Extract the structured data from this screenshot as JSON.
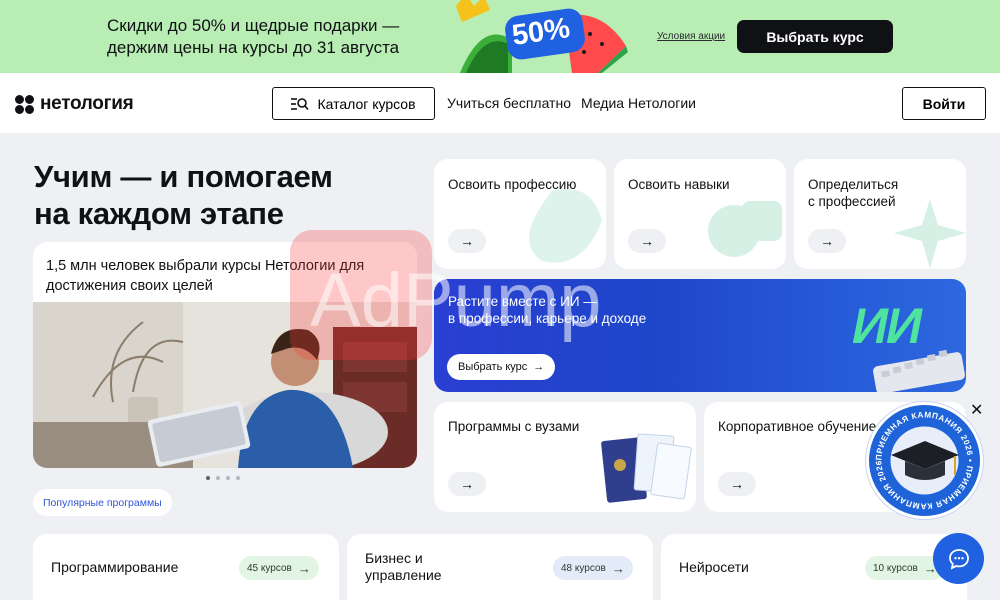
{
  "promo": {
    "line1": "Скидки до 50% и щедрые подарки —",
    "line2": "держим цены на курсы до 31 августа",
    "badge": "50%",
    "terms": "Условия акции",
    "cta": "Выбрать курс"
  },
  "header": {
    "logo": "нетология",
    "catalog": "Каталог курсов",
    "nav": [
      "Учиться бесплатно",
      "Медиа Нетологии"
    ],
    "login": "Войти"
  },
  "hero": {
    "title_line1": "Учим — и помогаем",
    "title_line2": "на каждом этапе",
    "card_text": "1,5 млн человек выбрали курсы Нетологии для достижения своих целей",
    "popular": "Популярные программы"
  },
  "tiles": {
    "profession": "Освоить профессию",
    "skills": "Освоить навыки",
    "decide_line1": "Определиться",
    "decide_line2": "с профессией",
    "universities": "Программы с вузами",
    "corporate": "Корпоративное обучение",
    "arrow": "→"
  },
  "ai_banner": {
    "line1": "Растите вместе с ИИ —",
    "line2": "в профессии, карьере и доходе",
    "button": "Выбрать курс",
    "art_text": "ИИ"
  },
  "categories": [
    {
      "title_line1": "Программирование",
      "title_line2": "",
      "count": "45 курсов"
    },
    {
      "title_line1": "Бизнес и",
      "title_line2": "управление",
      "count": "48 курсов"
    },
    {
      "title_line1": "Нейросети",
      "title_line2": "",
      "count": "10 курсов"
    }
  ],
  "stamp": {
    "text": "ПРИЕМНАЯ КАМПАНИЯ 2026 • ПРИЕМНАЯ КАМПАНИЯ 2026 •"
  },
  "watermark": "AdPump",
  "colors": {
    "promo_bg": "#b8edb3",
    "accent_blue": "#1f61e0",
    "page_bg": "#eef0f4"
  }
}
